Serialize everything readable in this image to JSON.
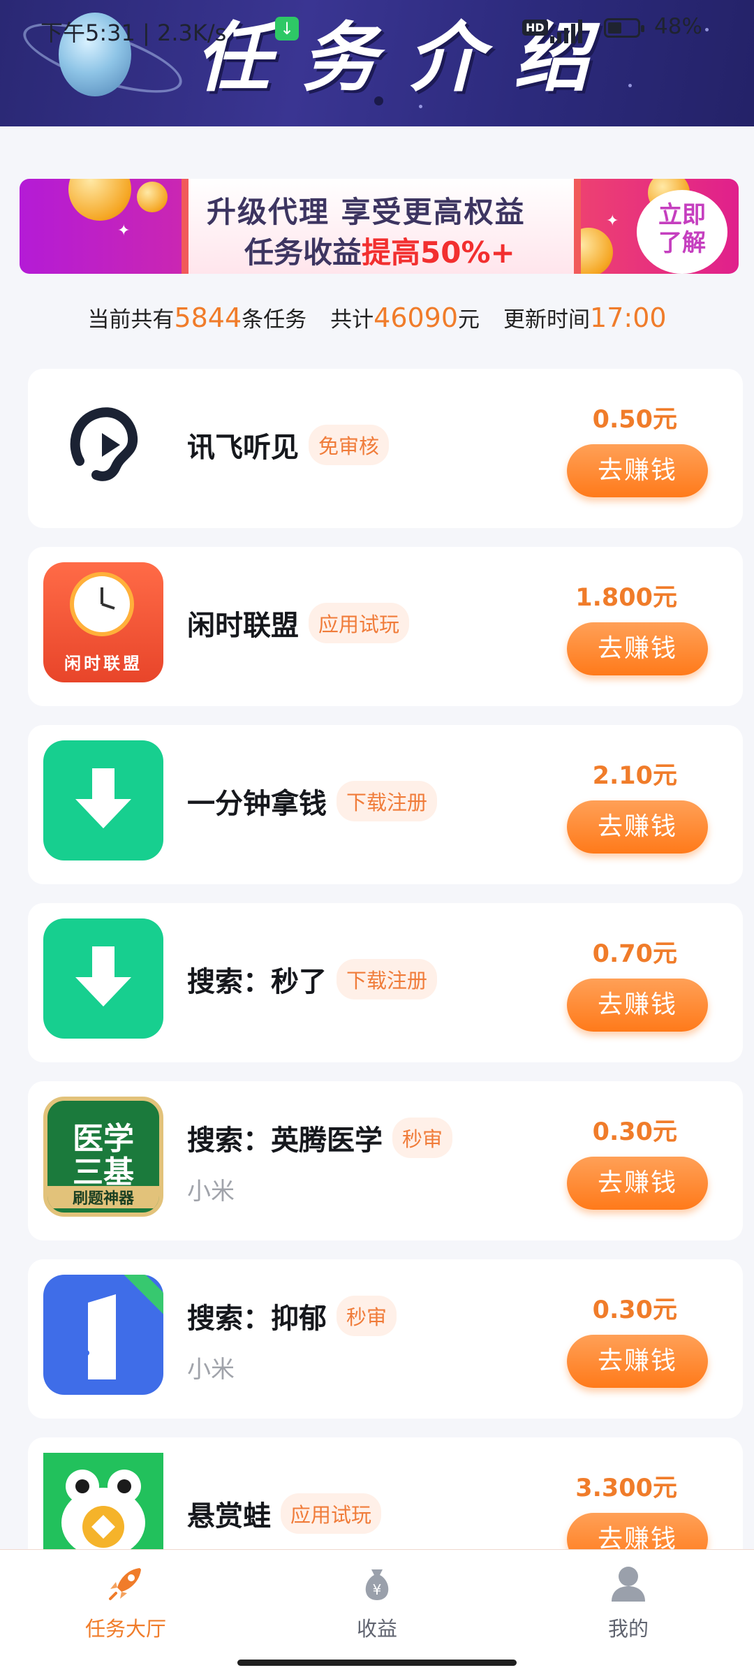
{
  "status_bar": {
    "time": "下午5:31",
    "net_speed": "2.3K/s",
    "battery_percent": "48%",
    "battery_level": 0.48,
    "hd_badge": "HD"
  },
  "header": {
    "title": "任务介绍"
  },
  "promo": {
    "line1": "升级代理   享受更高权益",
    "line2_prefix": "任务收益",
    "line2_highlight": "提高50%+",
    "cta": "立即了解"
  },
  "summary": {
    "prefix": "当前共有",
    "task_count": "5844",
    "task_unit": "条任务",
    "total_prefix": "共计",
    "total_amount": "46090",
    "total_unit": "元",
    "update_prefix": "更新时间",
    "update_time": "17:00"
  },
  "tasks": [
    {
      "title": "讯飞听见",
      "tag": "免审核",
      "subtitle": "",
      "price": "0.50元",
      "button": "去赚钱",
      "icon": "ear-play-icon"
    },
    {
      "title": "闲时联盟",
      "tag": "应用试玩",
      "subtitle": "",
      "price": "1.800元",
      "button": "去赚钱",
      "icon": "clock-envelope-icon",
      "icon_text": "闲时联盟"
    },
    {
      "title": "一分钟拿钱",
      "tag": "下载注册",
      "subtitle": "",
      "price": "2.10元",
      "button": "去赚钱",
      "icon": "download-icon"
    },
    {
      "title": "搜索：秒了",
      "tag": "下载注册",
      "subtitle": "",
      "price": "0.70元",
      "button": "去赚钱",
      "icon": "download-icon"
    },
    {
      "title": "搜索：英腾医学",
      "tag": "秒审",
      "subtitle": "小米",
      "price": "0.30元",
      "button": "去赚钱",
      "icon": "medical-book-icon",
      "icon_text_top": "医学",
      "icon_text_mid": "三基",
      "icon_text_bottom": "刷题神器"
    },
    {
      "title": "搜索：抑郁",
      "tag": "秒审",
      "subtitle": "小米",
      "price": "0.30元",
      "button": "去赚钱",
      "icon": "door-one-icon"
    },
    {
      "title": "悬赏蛙",
      "tag": "应用试玩",
      "subtitle": "",
      "price": "3.300元",
      "button": "去赚钱",
      "icon": "frog-coin-icon"
    }
  ],
  "bottom_nav": [
    {
      "label": "任务大厅",
      "icon": "rocket-icon",
      "active": true
    },
    {
      "label": "收益",
      "icon": "money-bag-icon",
      "active": false
    },
    {
      "label": "我的",
      "icon": "user-icon",
      "active": false
    }
  ],
  "colors": {
    "accent": "#f07c2a",
    "button_gradient_top": "#ffa057",
    "button_gradient_bottom": "#ff7a1a",
    "banner_bg": "#2f2d86",
    "tag_bg": "#fff0e8",
    "download_green": "#17cf8f"
  }
}
